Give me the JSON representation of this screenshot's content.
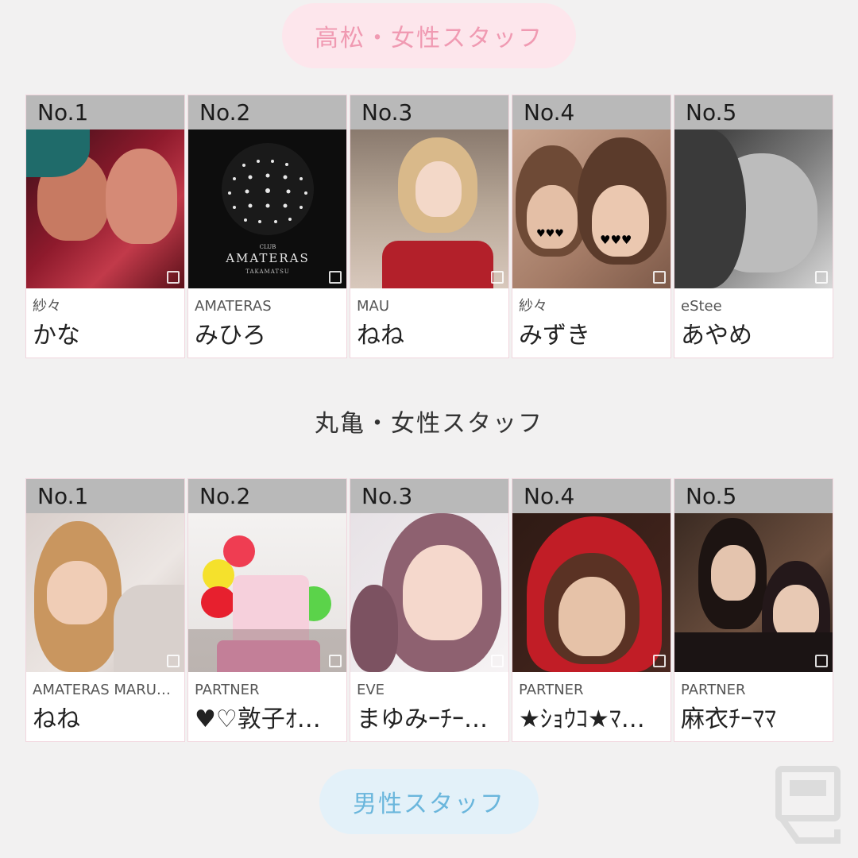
{
  "sections": [
    {
      "title": "高松・女性スタッフ",
      "cards": [
        {
          "rank": "No.1",
          "shop": "紗々",
          "name": "かな"
        },
        {
          "rank": "No.2",
          "shop": "AMATERAS",
          "name": "みひろ",
          "logo_club": "CLUB",
          "logo_name": "AMATERAS",
          "logo_city": "TAKAMATSU"
        },
        {
          "rank": "No.3",
          "shop": "MAU",
          "name": "ねね"
        },
        {
          "rank": "No.4",
          "shop": "紗々",
          "name": "みずき"
        },
        {
          "rank": "No.5",
          "shop": "eStee",
          "name": "あやめ"
        }
      ]
    },
    {
      "title": "丸亀・女性スタッフ",
      "cards": [
        {
          "rank": "No.1",
          "shop": "AMATERAS MARU…",
          "name": "ねね"
        },
        {
          "rank": "No.2",
          "shop": "PARTNER",
          "name": "♥♡敦子ｵ…"
        },
        {
          "rank": "No.3",
          "shop": "EVE",
          "name": "まゆみｰﾁｰ…"
        },
        {
          "rank": "No.4",
          "shop": "PARTNER",
          "name": "★ｼｮｳｺ★ﾏ…"
        },
        {
          "rank": "No.5",
          "shop": "PARTNER",
          "name": "麻衣ﾁｰﾏﾏ"
        }
      ]
    }
  ],
  "male_button": "男性スタッフ",
  "icons": {
    "watermark": "site-logo-icon"
  },
  "colors": {
    "pink_pill": "#fde6ec",
    "pink_text": "#f09ab2",
    "blue_pill": "#e3f1f9",
    "blue_text": "#6ab6dc",
    "rank_bar": "#b9b9b9"
  }
}
